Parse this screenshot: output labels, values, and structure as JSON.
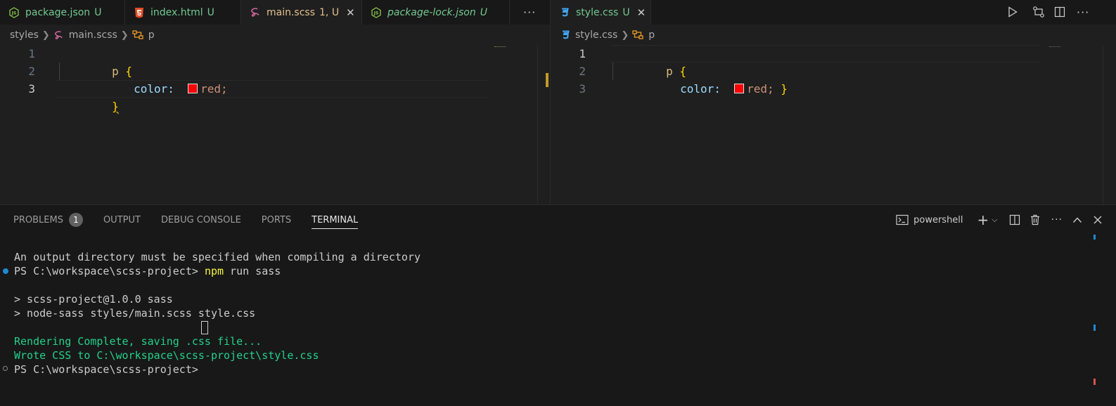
{
  "left_tabs": [
    {
      "label": "package.json",
      "status": "U",
      "icon": "js-json-icon",
      "italic": false,
      "active": false
    },
    {
      "label": "index.html",
      "status": "U",
      "icon": "html5-icon",
      "italic": false,
      "active": false
    },
    {
      "label": "main.scss",
      "status": "1, U",
      "icon": "sass-icon",
      "italic": false,
      "active": true
    },
    {
      "label": "package-lock.json",
      "status": "U",
      "icon": "js-json-icon",
      "italic": true,
      "active": false
    }
  ],
  "left_more": "···",
  "right_tabs": [
    {
      "label": "style.css",
      "status": "U",
      "icon": "css3-icon",
      "active": true
    }
  ],
  "right_more": "···",
  "left_breadcrumb": {
    "folder": "styles",
    "file": "main.scss",
    "symbol": "p"
  },
  "right_breadcrumb": {
    "file": "style.css",
    "symbol": "p"
  },
  "left_code": {
    "numbers": [
      "1",
      "2",
      "3"
    ],
    "line1_selector": "p",
    "line1_brace": "{",
    "line2_property": "color:",
    "line2_value": "red;",
    "line3_brace": "}"
  },
  "right_code": {
    "numbers": [
      "1",
      "2",
      "3"
    ],
    "line1_selector": "p",
    "line1_brace": "{",
    "line2_property": "color:",
    "line2_value": "red;",
    "line2_brace": "}"
  },
  "panel": {
    "tabs": [
      "PROBLEMS",
      "OUTPUT",
      "DEBUG CONSOLE",
      "PORTS",
      "TERMINAL"
    ],
    "problems_count": "1",
    "active_tab": "TERMINAL",
    "shell": "powershell"
  },
  "terminal": {
    "line1": "An output directory must be specified when compiling a directory",
    "line2_prompt": "PS C:\\workspace\\scss-project> ",
    "line2_cmd": "npm",
    "line2_args": " run sass",
    "line3": "> scss-project@1.0.0 sass",
    "line4": "> node-sass styles/main.scss style.css",
    "line5": "Rendering Complete, saving .css file...",
    "line6": "Wrote CSS to C:\\workspace\\scss-project\\style.css",
    "line7_prompt": "PS C:\\workspace\\scss-project>"
  },
  "colors": {
    "untracked": "#73c991",
    "modified_warning": "#e2c08d",
    "terminal_green": "#23d18b",
    "terminal_yellow": "#f5f543",
    "swatch": "#ff0000"
  }
}
